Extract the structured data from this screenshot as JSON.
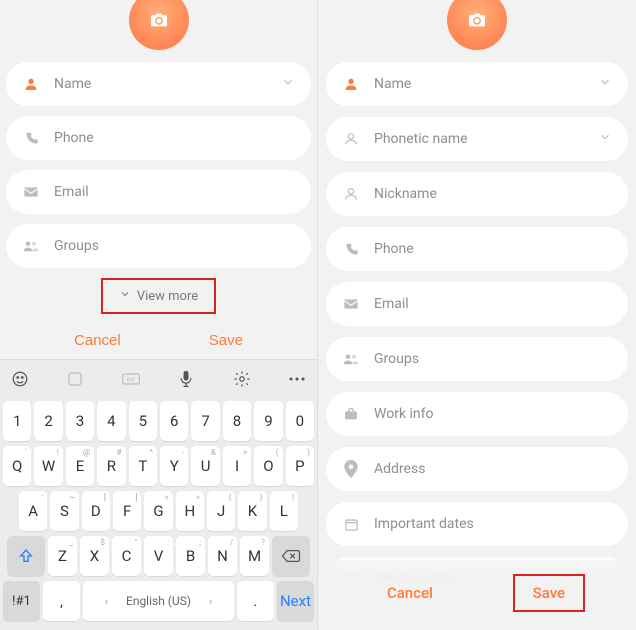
{
  "left": {
    "fields": {
      "name": "Name",
      "phone": "Phone",
      "email": "Email",
      "groups": "Groups"
    },
    "view_more": "View more",
    "actions": {
      "cancel": "Cancel",
      "save": "Save"
    },
    "keyboard": {
      "nums": [
        "1",
        "2",
        "3",
        "4",
        "5",
        "6",
        "7",
        "8",
        "9",
        "0"
      ],
      "r1": [
        "Q",
        "W",
        "E",
        "R",
        "T",
        "Y",
        "U",
        "I",
        "O",
        "P"
      ],
      "r2": [
        "A",
        "S",
        "D",
        "F",
        "G",
        "H",
        "J",
        "K",
        "L"
      ],
      "r3": [
        "Z",
        "X",
        "C",
        "V",
        "B",
        "N",
        "M"
      ],
      "space_lang": "English (US)",
      "sym": "!#1",
      "comma": ",",
      "period": ".",
      "next": "Next"
    }
  },
  "right": {
    "fields": {
      "name": "Name",
      "phonetic": "Phonetic name",
      "nickname": "Nickname",
      "phone": "Phone",
      "email": "Email",
      "groups": "Groups",
      "work": "Work info",
      "address": "Address",
      "dates": "Important dates",
      "relationships": "Relationships"
    },
    "actions": {
      "cancel": "Cancel",
      "save": "Save"
    }
  }
}
